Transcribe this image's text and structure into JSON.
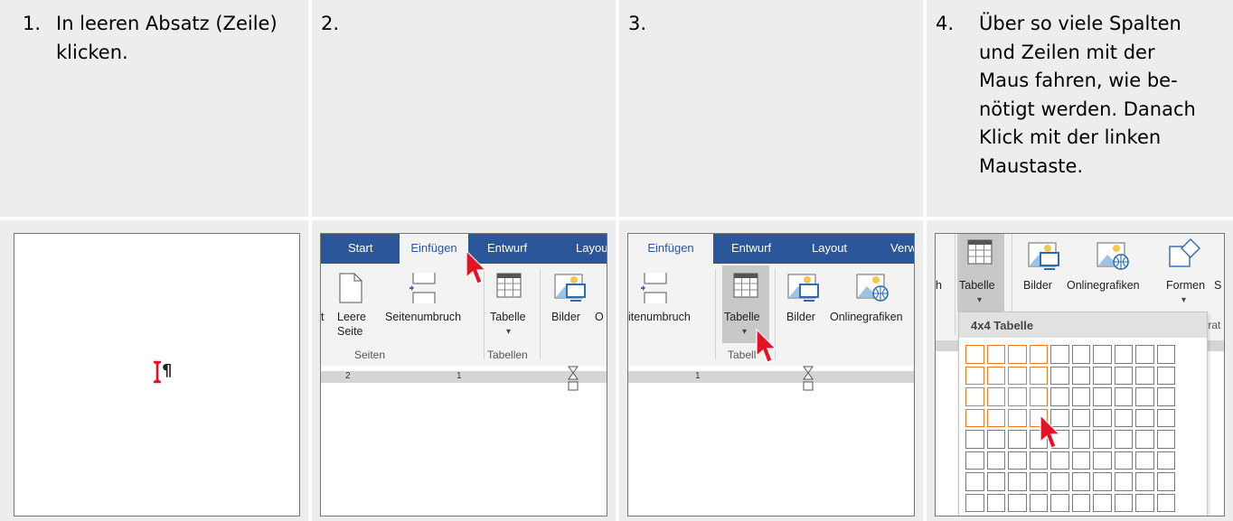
{
  "steps": [
    {
      "number": "1.",
      "lines": [
        "In leeren Absatz (Zeile)",
        "klicken."
      ]
    },
    {
      "number": "2.",
      "lines": []
    },
    {
      "number": "3.",
      "lines": []
    },
    {
      "number": "4.",
      "lines": [
        "Über so viele Spalten",
        "und Zeilen mit der",
        "Maus fahren, wie be-",
        "nötigt werden. Danach",
        "Klick mit der linken",
        "Maustaste."
      ]
    }
  ],
  "panel1": {
    "pilcrow": "¶"
  },
  "panel2": {
    "tabs": [
      "Start",
      "Einfügen",
      "Entwurf",
      "Layou"
    ],
    "buttons": {
      "leere_seite_1": "Leere",
      "leere_seite_2": "Seite",
      "seitenumbruch": "Seitenumbruch",
      "tabelle": "Tabelle",
      "bilder": "Bilder",
      "cut_left": "t",
      "cut_right": "O"
    },
    "groups": {
      "seiten": "Seiten",
      "tabellen": "Tabellen"
    },
    "ruler": {
      "n1": "2",
      "n2": "1"
    }
  },
  "panel3": {
    "tabs": [
      "Einfügen",
      "Entwurf",
      "Layout",
      "Verw"
    ],
    "buttons": {
      "seitenumbruch": "itenumbruch",
      "tabelle": "Tabelle",
      "bilder": "Bilder",
      "onlinegrafiken": "Onlinegrafiken"
    },
    "groups": {
      "tabellen": "Tabell"
    },
    "ruler": {
      "n1": "1"
    }
  },
  "panel4": {
    "buttons": {
      "cut_left": "h",
      "tabelle": "Tabelle",
      "bilder": "Bilder",
      "onlinegrafiken": "Onlinegrafiken",
      "formen": "Formen",
      "cut_right": "S"
    },
    "dropdown_title": "4x4 Tabelle",
    "behind_text": "trat",
    "grid": {
      "cols": 10,
      "rows": 8,
      "selected_cols": 4,
      "selected_rows": 4
    },
    "colors": {
      "selected": "#f07822",
      "normal": "#7a7a7a"
    }
  },
  "colors": {
    "cell_bg": "#ededed",
    "tab_bar": "#2b579a",
    "ribbon_bg": "#f3f3f3",
    "cursor": "#e81123"
  }
}
